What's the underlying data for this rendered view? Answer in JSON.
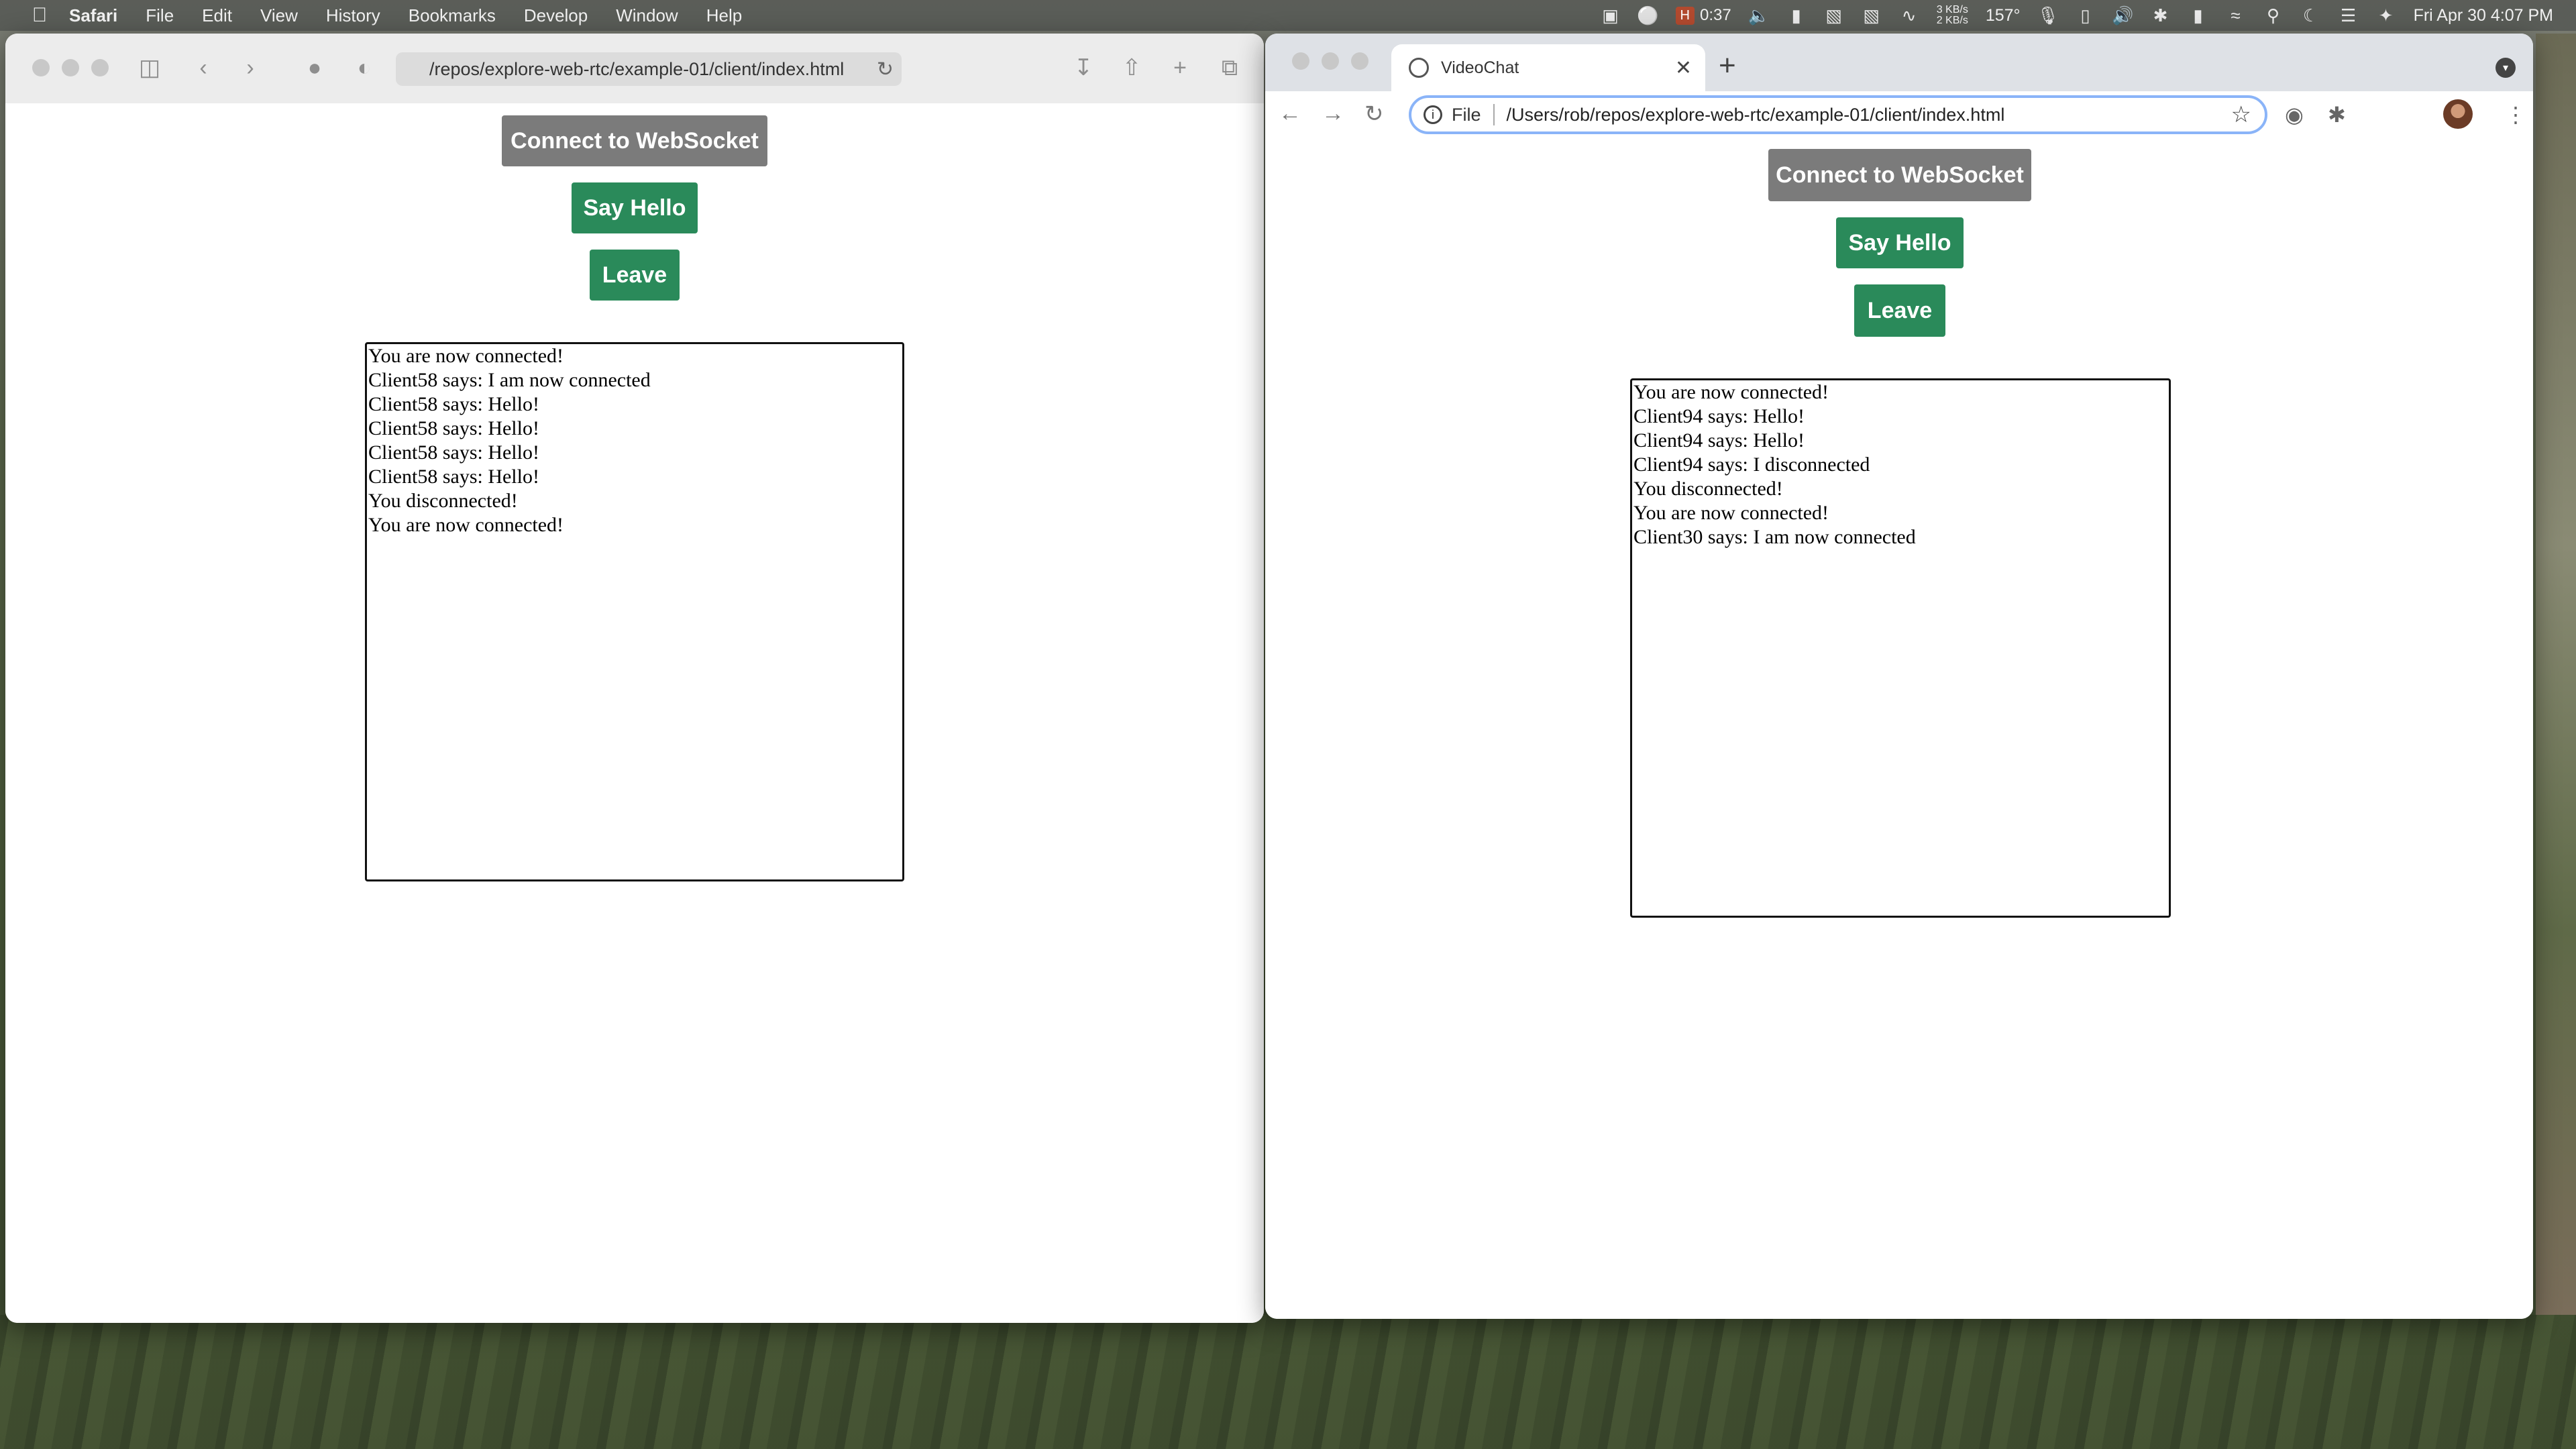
{
  "menubar": {
    "app_name": "Safari",
    "items": [
      "File",
      "Edit",
      "View",
      "History",
      "Bookmarks",
      "Develop",
      "Window",
      "Help"
    ],
    "timer_badge": "H",
    "timer_value": "0:37",
    "network": [
      "3 KB/s",
      "2 KB/s"
    ],
    "temperature": "157°",
    "datetime": "Fri Apr 30  4:07 PM"
  },
  "safari": {
    "url": "/repos/explore-web-rtc/example-01/client/index.html",
    "page": {
      "connect_label": "Connect to WebSocket",
      "hello_label": "Say Hello",
      "leave_label": "Leave",
      "log": [
        "You are now connected!",
        "Client58 says: I am now connected",
        "Client58 says: Hello!",
        "Client58 says: Hello!",
        "Client58 says: Hello!",
        "Client58 says: Hello!",
        "You disconnected!",
        "You are now connected!"
      ]
    }
  },
  "chrome": {
    "tab_title": "VideoChat",
    "omnibox_scheme": "File",
    "url": "/Users/rob/repos/explore-web-rtc/example-01/client/index.html",
    "page": {
      "connect_label": "Connect to WebSocket",
      "hello_label": "Say Hello",
      "leave_label": "Leave",
      "log": [
        "You are now connected!",
        "Client94 says: Hello!",
        "Client94 says: Hello!",
        "Client94 says: I disconnected",
        "You disconnected!",
        "You are now connected!",
        "Client30 says: I am now connected"
      ]
    }
  },
  "colors": {
    "button_green": "#2a8a5a",
    "button_gray": "#7b7b7b"
  }
}
